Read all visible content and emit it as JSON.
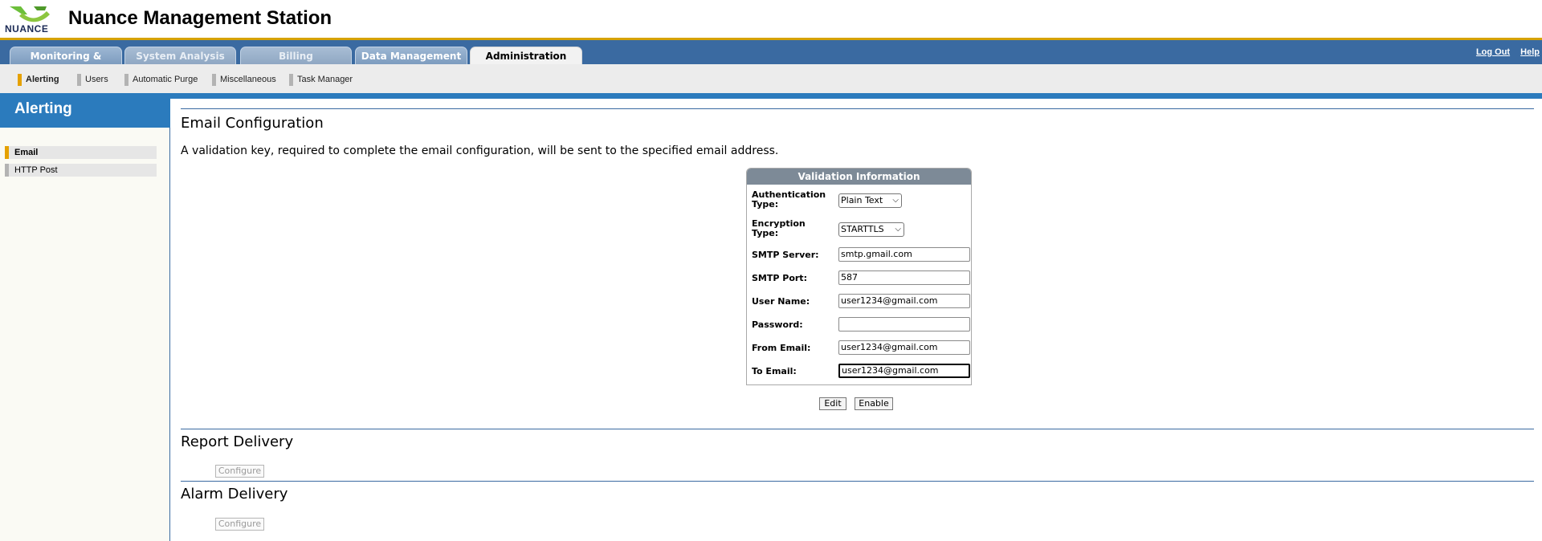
{
  "app": {
    "logo_text": "NUANCE",
    "title": "Nuance Management Station"
  },
  "tabs": [
    {
      "label": "Monitoring & Control"
    },
    {
      "label": "System Analysis"
    },
    {
      "label": "Billing"
    },
    {
      "label": "Data Management"
    },
    {
      "label": "Administration",
      "active": true
    }
  ],
  "toplinks": {
    "logout": "Log Out",
    "help": "Help"
  },
  "subnav": [
    {
      "label": "Alerting",
      "active": true
    },
    {
      "label": "Users"
    },
    {
      "label": "Automatic Purge"
    },
    {
      "label": "Miscellaneous"
    },
    {
      "label": "Task Manager"
    }
  ],
  "sidebar": {
    "title": "Alerting",
    "items": [
      {
        "label": "Email",
        "active": true
      },
      {
        "label": "HTTP Post"
      }
    ]
  },
  "email_config": {
    "title": "Email Configuration",
    "note": "A validation key, required to complete the email configuration, will be sent to the specified email address.",
    "box_title": "Validation Information",
    "auth_label_1": "Authentication",
    "auth_label_2": "Type:",
    "auth_value": "Plain Text",
    "enc_label_1": "Encryption",
    "enc_label_2": "Type:",
    "enc_value": "STARTTLS",
    "smtp_server_label": "SMTP Server:",
    "smtp_server_value": "smtp.gmail.com",
    "smtp_port_label": "SMTP Port:",
    "smtp_port_value": "587",
    "user_name_label": "User Name:",
    "user_name_value": "user1234@gmail.com",
    "password_label": "Password:",
    "password_value": "",
    "from_email_label": "From Email:",
    "from_email_value": "user1234@gmail.com",
    "to_email_label": "To Email:",
    "to_email_value": "user1234@gmail.com",
    "edit_label": "Edit",
    "enable_label": "Enable"
  },
  "report_delivery": {
    "title": "Report Delivery",
    "button": "Configure"
  },
  "alarm_delivery": {
    "title": "Alarm Delivery",
    "button": "Configure"
  }
}
